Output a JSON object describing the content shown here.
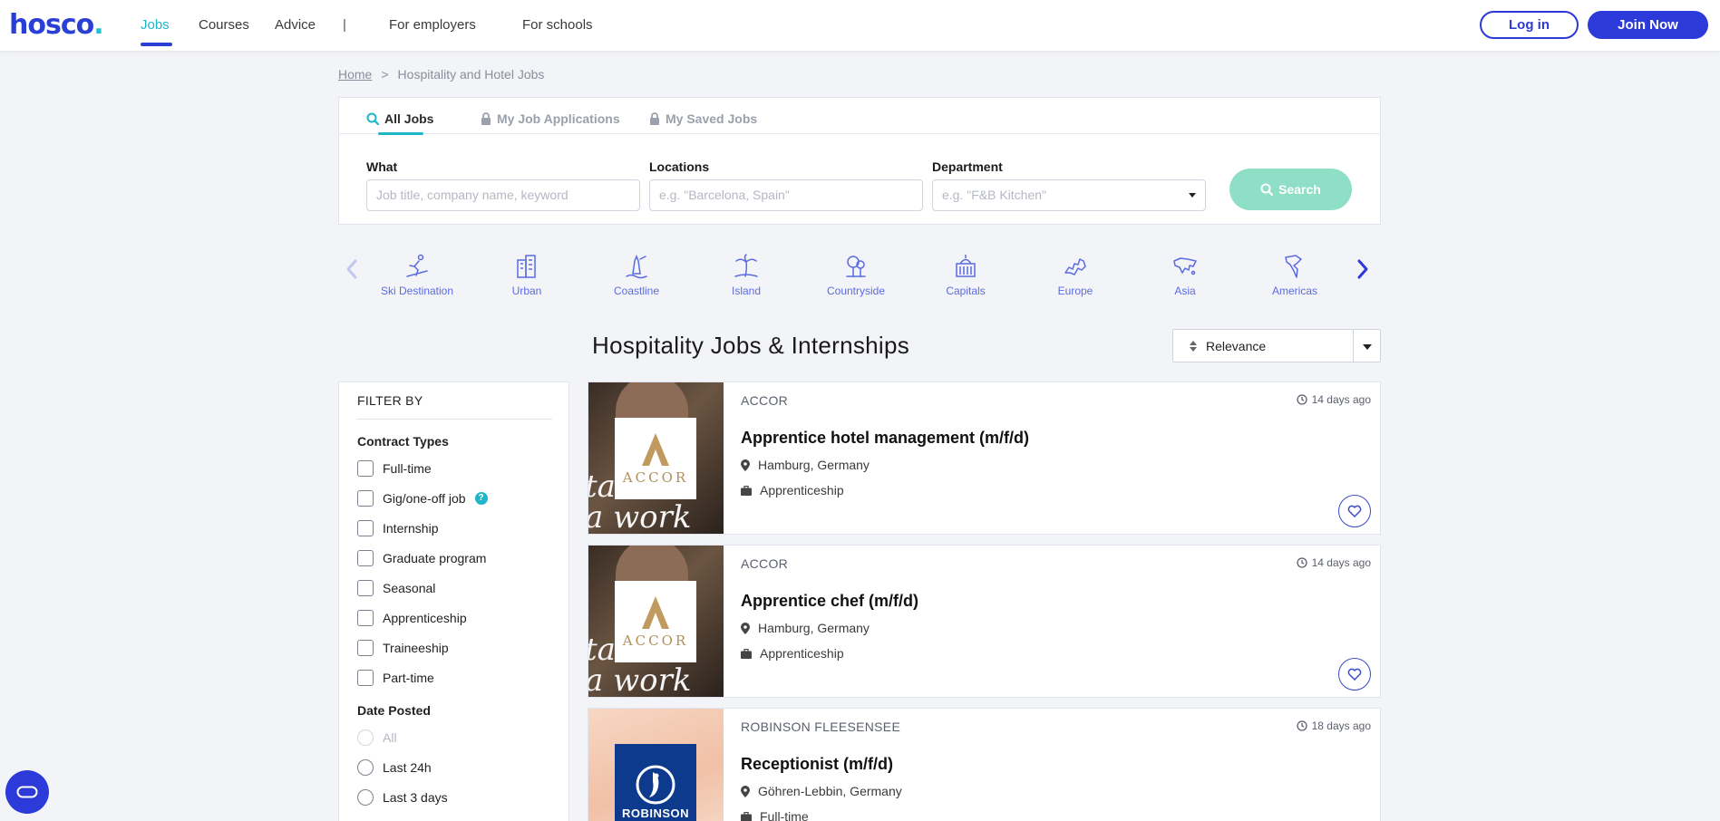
{
  "nav": {
    "logo": "hosco",
    "logo_dot": ".",
    "links": [
      {
        "label": "Jobs",
        "active": true
      },
      {
        "label": "Courses"
      },
      {
        "label": "Advice"
      },
      {
        "label": "|"
      },
      {
        "label": "For employers"
      },
      {
        "label": "For schools"
      }
    ],
    "login_label": "Log in",
    "join_label": "Join Now"
  },
  "breadcrumb": {
    "home": "Home",
    "sep": ">",
    "current": "Hospitality and Hotel Jobs"
  },
  "search": {
    "tabs": [
      {
        "label": "All Jobs",
        "icon": "search-icon",
        "active": true
      },
      {
        "label": "My Job Applications",
        "icon": "lock-icon"
      },
      {
        "label": "My Saved Jobs",
        "icon": "lock-icon"
      }
    ],
    "what_label": "What",
    "what_placeholder": "Job title, company name, keyword",
    "locations_label": "Locations",
    "locations_placeholder": "e.g. \"Barcelona, Spain\"",
    "department_label": "Department",
    "department_placeholder": "e.g. \"F&B Kitchen\"",
    "search_button": "Search"
  },
  "destinations": [
    {
      "label": "Ski Destination",
      "icon": "skier-icon"
    },
    {
      "label": "Urban",
      "icon": "buildings-icon"
    },
    {
      "label": "Coastline",
      "icon": "lighthouse-icon"
    },
    {
      "label": "Island",
      "icon": "palm-tree-icon"
    },
    {
      "label": "Countryside",
      "icon": "tree-icon"
    },
    {
      "label": "Capitals",
      "icon": "capitol-icon"
    },
    {
      "label": "Europe",
      "icon": "europe-map-icon"
    },
    {
      "label": "Asia",
      "icon": "asia-map-icon"
    },
    {
      "label": "Americas",
      "icon": "americas-map-icon"
    }
  ],
  "results": {
    "title": "Hospitality Jobs & Internships",
    "sort_label": "Relevance"
  },
  "filter": {
    "header": "FILTER BY",
    "contract_title": "Contract Types",
    "contract_types": [
      "Full-time",
      "Gig/one-off job",
      "Internship",
      "Graduate program",
      "Seasonal",
      "Apprenticeship",
      "Traineeship",
      "Part-time"
    ],
    "gig_help": "?",
    "date_title": "Date Posted",
    "date_options": [
      "All",
      "Last 24h",
      "Last 3 days"
    ]
  },
  "jobs": [
    {
      "company": "ACCOR",
      "posted": "14 days ago",
      "title": "Apprentice hotel management (m/f/d)",
      "location": "Hamburg, Germany",
      "type": "Apprenticeship",
      "logo_text": "ACCOR",
      "thumb_text": "ta\na work fh"
    },
    {
      "company": "ACCOR",
      "posted": "14 days ago",
      "title": "Apprentice chef (m/f/d)",
      "location": "Hamburg, Germany",
      "type": "Apprenticeship",
      "logo_text": "ACCOR",
      "thumb_text": "ta\na work fh"
    },
    {
      "company": "ROBINSON FLEESENSEE",
      "posted": "18 days ago",
      "title": "Receptionist (m/f/d)",
      "location": "Göhren-Lebbin, Germany",
      "type": "Full-time",
      "logo_text": "ROBINSON"
    }
  ],
  "colors": {
    "brand": "#2b3ad8",
    "accent": "#1fb6c9",
    "search_button": "#8fdfc7",
    "destination": "#5b6be0"
  }
}
